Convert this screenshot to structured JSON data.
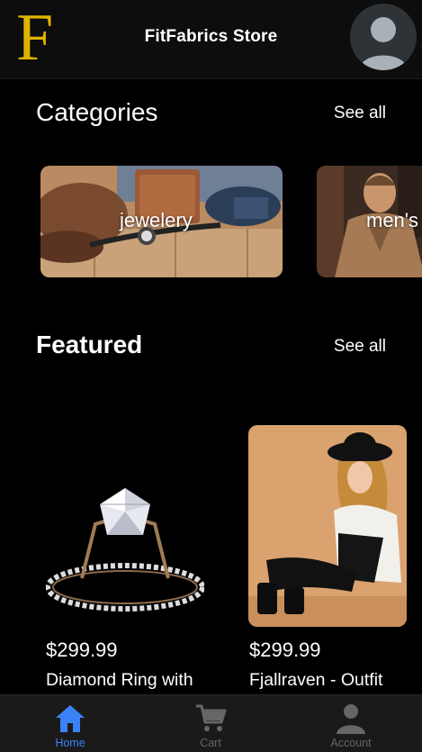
{
  "header": {
    "logo_text": "F",
    "title": "FitFabrics Store",
    "avatar_icon": "user-avatar-icon"
  },
  "categories": {
    "heading": "Categories",
    "see_all": "See all",
    "items": [
      {
        "label": "jewelery"
      },
      {
        "label": "men's"
      }
    ]
  },
  "featured": {
    "heading": "Featured",
    "see_all": "See all",
    "products": [
      {
        "price": "$299.99",
        "name": "Diamond Ring with"
      },
      {
        "price": "$299.99",
        "name": "Fjallraven - Outfit"
      }
    ]
  },
  "bottom_nav": {
    "items": [
      {
        "label": "Home",
        "icon": "home-icon",
        "active": true
      },
      {
        "label": "Cart",
        "icon": "cart-icon",
        "active": false
      },
      {
        "label": "Account",
        "icon": "account-icon",
        "active": false
      }
    ]
  },
  "colors": {
    "background": "#000000",
    "header_bg": "#0d0d0d",
    "logo": "#e0b300",
    "nav_active": "#3b82f6",
    "nav_inactive": "#666666"
  }
}
